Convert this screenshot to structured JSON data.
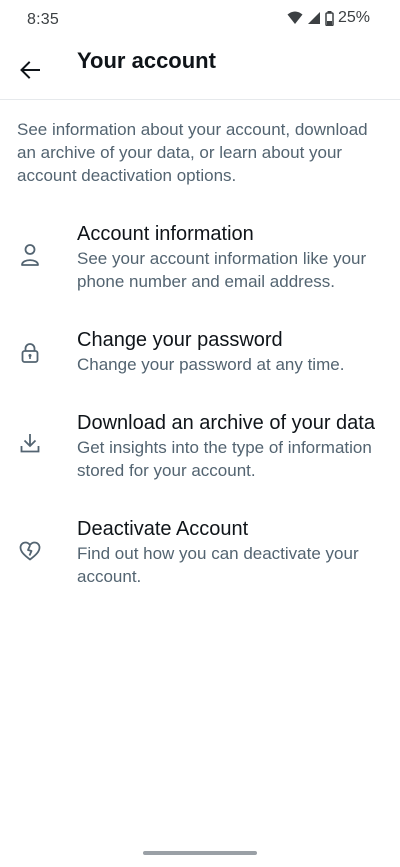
{
  "status_bar": {
    "time": "8:35",
    "battery": "25%",
    "icons": [
      "wifi-icon",
      "signal-icon",
      "battery-icon"
    ]
  },
  "header": {
    "back_icon": "arrow-left-icon",
    "title": "Your account"
  },
  "intro": "See information about your account, download an archive of your data, or learn about your account deactivation options.",
  "menu": {
    "items": [
      {
        "icon": "person-icon",
        "title": "Account information",
        "description": "See your account information like your phone number and email address."
      },
      {
        "icon": "lock-icon",
        "title": "Change your password",
        "description": "Change your password at any time."
      },
      {
        "icon": "download-icon",
        "title": "Download an archive of your data",
        "description": "Get insights into the type of information stored for your account."
      },
      {
        "icon": "broken-heart-icon",
        "title": "Deactivate Account",
        "description": "Find out how you can deactivate your account."
      }
    ]
  },
  "colors": {
    "primary_text": "#0f1419",
    "secondary_text": "#536471",
    "divider": "#e6e9ec"
  }
}
